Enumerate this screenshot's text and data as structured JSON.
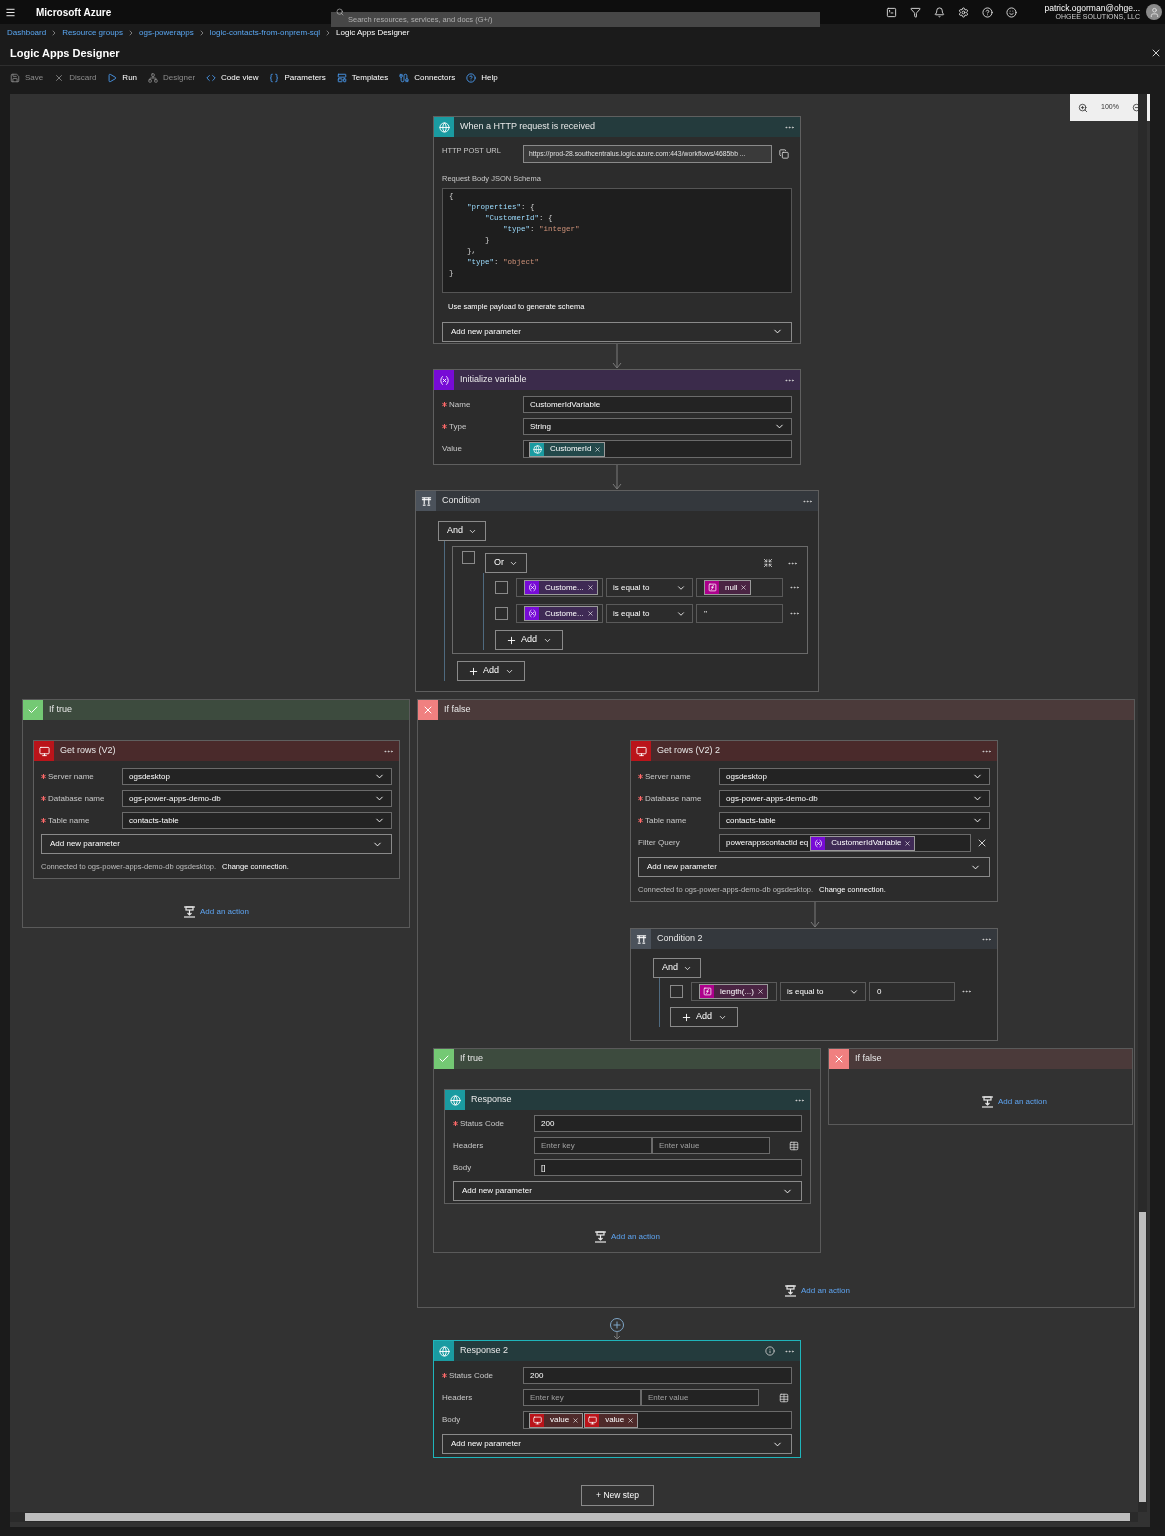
{
  "topbar": {
    "brand": "Microsoft Azure",
    "search": {
      "placeholder": "Search resources, services, and docs (G+/)"
    },
    "user": {
      "name": "patrick.ogorman@ohge...",
      "org": "OHGEE SOLUTIONS, LLC"
    }
  },
  "breadcrumb": [
    {
      "label": "Dashboard",
      "current": false
    },
    {
      "label": "Resource groups",
      "current": false
    },
    {
      "label": "ogs-powerapps",
      "current": false
    },
    {
      "label": "logic-contacts-from-onprem-sql",
      "current": false
    },
    {
      "label": "Logic Apps Designer",
      "current": true
    }
  ],
  "blade": {
    "title": "Logic Apps Designer"
  },
  "toolbar": [
    {
      "label": "Save",
      "disabled": true
    },
    {
      "label": "Discard",
      "disabled": true
    },
    {
      "label": "Run",
      "disabled": false
    },
    {
      "label": "Designer",
      "disabled": true
    },
    {
      "label": "Code view",
      "disabled": false
    },
    {
      "label": "Parameters",
      "disabled": false
    },
    {
      "label": "Templates",
      "disabled": false
    },
    {
      "label": "Connectors",
      "disabled": false
    },
    {
      "label": "Help",
      "disabled": false
    }
  ],
  "zoom": {
    "value": "100%"
  },
  "trigger": {
    "kind": "request",
    "title": "When a HTTP request is received",
    "selected": false,
    "url_label": "HTTP POST URL",
    "url": "https://prod-28.southcentralus.logic.azure.com:443/workflows/4685bb ...",
    "schema_label": "Request Body JSON Schema",
    "schema": [
      [
        {
          "kind": "punct",
          "text": "{"
        }
      ],
      [
        {
          "kind": "key",
          "text": "    \"properties\""
        },
        {
          "kind": "punct",
          "text": ": {"
        }
      ],
      [
        {
          "kind": "key",
          "text": "        \"CustomerId\""
        },
        {
          "kind": "punct",
          "text": ": {"
        }
      ],
      [
        {
          "kind": "key",
          "text": "            \"type\""
        },
        {
          "kind": "punct",
          "text": ": "
        },
        {
          "kind": "string",
          "text": "\"integer\""
        }
      ],
      [
        {
          "kind": "punct",
          "text": "        }"
        }
      ],
      [
        {
          "kind": "punct",
          "text": "    },"
        }
      ],
      [
        {
          "kind": "key",
          "text": "    \"type\""
        },
        {
          "kind": "punct",
          "text": ": "
        },
        {
          "kind": "string",
          "text": "\"object\""
        }
      ],
      [
        {
          "kind": "punct",
          "text": "}"
        }
      ]
    ],
    "sample_link": "Use sample payload to generate schema",
    "add_parameter": "Add new parameter"
  },
  "init_variable": {
    "kind": "variable",
    "title": "Initialize variable",
    "selected": false,
    "fields": [
      {
        "label": "Name",
        "required": true,
        "kind": "text",
        "value": "CustomerIdVariable"
      },
      {
        "label": "Type",
        "required": true,
        "kind": "dropdown",
        "value": "String"
      },
      {
        "label": "Value",
        "required": false,
        "kind": "tokens",
        "tokens": [
          {
            "kind": "request",
            "text": "CustomerId"
          }
        ]
      }
    ]
  },
  "condition": {
    "kind": "condition",
    "title": "Condition",
    "selected": false,
    "operator": "And",
    "group": {
      "checked": false,
      "operator": "Or",
      "rows": [
        {
          "checked": false,
          "left": {
            "kind": "variable",
            "text": "Custome..."
          },
          "op": "is equal to",
          "right": {
            "kind": "token",
            "token": {
              "kind": "expression",
              "text": "null"
            }
          }
        },
        {
          "checked": false,
          "left": {
            "kind": "variable",
            "text": "Custome..."
          },
          "op": "is equal to",
          "right": {
            "kind": "text",
            "text": "''"
          }
        }
      ],
      "add": "Add"
    },
    "add": "Add"
  },
  "if_true": {
    "label": "If true",
    "action": {
      "kind": "sql",
      "title": "Get rows (V2)",
      "selected": false,
      "fields": [
        {
          "label": "Server name",
          "required": true,
          "kind": "dropdown",
          "value": "ogsdesktop"
        },
        {
          "label": "Database name",
          "required": true,
          "kind": "dropdown",
          "value": "ogs-power-apps-demo-db"
        },
        {
          "label": "Table name",
          "required": true,
          "kind": "dropdown",
          "value": "contacts-table"
        }
      ],
      "add_parameter": "Add new parameter",
      "connection": "Connected to ogs-power-apps-demo-db ogsdesktop.",
      "change_connection": "Change connection."
    },
    "add_action": "Add an action"
  },
  "if_false": {
    "label": "If false",
    "action": {
      "kind": "sql",
      "title": "Get rows (V2) 2",
      "selected": false,
      "fields": [
        {
          "label": "Server name",
          "required": true,
          "kind": "dropdown",
          "value": "ogsdesktop"
        },
        {
          "label": "Database name",
          "required": true,
          "kind": "dropdown",
          "value": "ogs-power-apps-demo-db"
        },
        {
          "label": "Table name",
          "required": true,
          "kind": "dropdown",
          "value": "contacts-table"
        },
        {
          "label": "Filter Query",
          "required": false,
          "kind": "filter",
          "value": "powerappscontactid eq",
          "tokens": [
            {
              "kind": "variable",
              "text": "CustomerIdVariable"
            }
          ]
        }
      ],
      "add_parameter": "Add new parameter",
      "connection": "Connected to ogs-power-apps-demo-db ogsdesktop.",
      "change_connection": "Change connection."
    },
    "condition": {
      "kind": "condition",
      "title": "Condition 2",
      "selected": false,
      "operator": "And",
      "rows": [
        {
          "checked": false,
          "left": {
            "kind": "expression",
            "text": "length(...)"
          },
          "op": "is equal to",
          "right": {
            "kind": "text",
            "text": "0"
          }
        }
      ],
      "add": "Add",
      "if_true": {
        "label": "If true",
        "action": {
          "kind": "request",
          "title": "Response",
          "selected": false,
          "info": false,
          "fields": [
            {
              "label": "Status Code",
              "required": true,
              "kind": "text",
              "value": "200"
            },
            {
              "label": "Headers",
              "required": false,
              "kind": "keyvalue",
              "key_placeholder": "Enter key",
              "value_placeholder": "Enter value"
            },
            {
              "label": "Body",
              "required": false,
              "kind": "text",
              "value": "[]"
            }
          ],
          "add_parameter": "Add new parameter"
        },
        "add_action": "Add an action"
      },
      "if_false": {
        "label": "If false",
        "add_action": "Add an action"
      }
    },
    "add_action": "Add an action"
  },
  "response2": {
    "kind": "request",
    "title": "Response 2",
    "selected": true,
    "info": true,
    "fields": [
      {
        "label": "Status Code",
        "required": true,
        "kind": "text",
        "value": "200"
      },
      {
        "label": "Headers",
        "required": false,
        "kind": "keyvalue",
        "key_placeholder": "Enter key",
        "value_placeholder": "Enter value"
      },
      {
        "label": "Body",
        "required": false,
        "kind": "tokens",
        "tokens": [
          {
            "kind": "sql",
            "text": "value"
          },
          {
            "kind": "sql",
            "text": "value"
          }
        ]
      }
    ],
    "add_parameter": "Add new parameter"
  },
  "new_step": "+ New step"
}
